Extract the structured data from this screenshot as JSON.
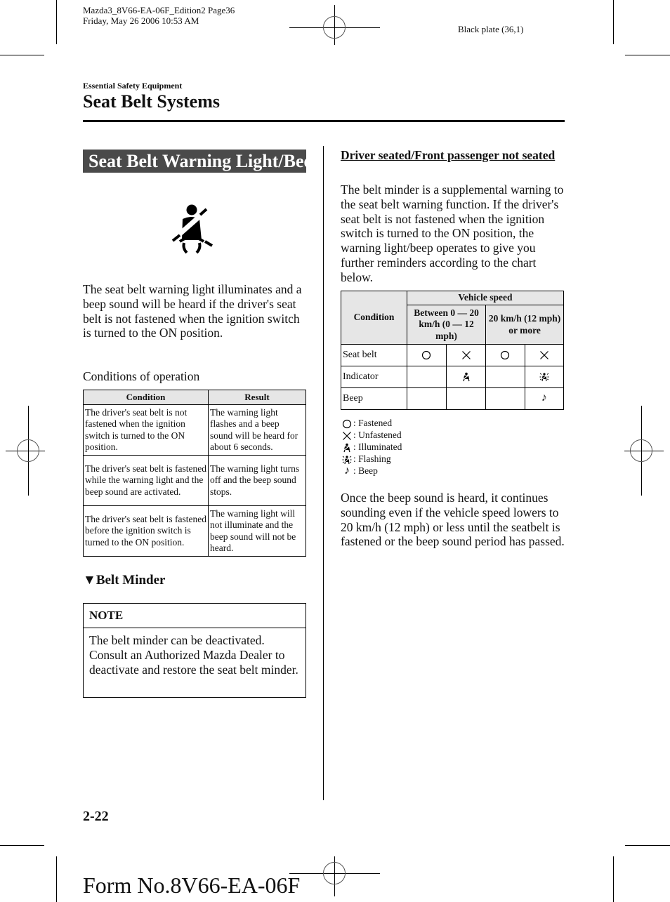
{
  "print_header": {
    "file_line": "Mazda3_8V66-EA-06F_Edition2 Page36",
    "date_line": "Friday, May 26 2006 10:53 AM",
    "plate": "Black plate (36,1)"
  },
  "section_label": "Essential Safety Equipment",
  "page_title": "Seat Belt Systems",
  "left_column": {
    "heading": "Seat Belt Warning Light/Beep",
    "warning_icon": "seat-belt-warning-icon",
    "intro": "The seat belt warning light illuminates and a beep sound will be heard if the driver's seat belt is not fastened when the ignition switch is turned to the ON position.",
    "conditions_label": "Conditions of operation",
    "conditions_table": {
      "headers": [
        "Condition",
        "Result"
      ],
      "rows": [
        [
          "The driver's seat belt is not fastened when the ignition switch is turned to the ON position.",
          "The warning light flashes and a beep sound will be heard for about 6 seconds."
        ],
        [
          "The driver's seat belt is fastened while the warning light and the beep sound are activated.",
          "The warning light turns off and the beep sound stops."
        ],
        [
          "The driver's seat belt is fastened before the ignition switch is turned to the ON position.",
          "The warning light will not illuminate and the beep sound will not be heard."
        ]
      ]
    },
    "belt_minder_heading": "Belt Minder",
    "note": {
      "title": "NOTE",
      "body": "The belt minder can be deactivated. Consult an Authorized Mazda Dealer to deactivate and restore the seat belt minder."
    }
  },
  "right_column": {
    "sub_heading": "Driver seated/Front passenger not seated",
    "intro": "The belt minder is a supplemental warning to the seat belt warning function. If the driver's seat belt is not fastened when the ignition switch is turned to the ON position, the warning light/beep operates to give you further reminders according to the chart below.",
    "speed_table": {
      "condition_header": "Condition",
      "group_header": "Vehicle speed",
      "speed_headers": [
        "Between 0 — 20 km/h (0 — 12 mph)",
        "20 km/h (12 mph) or more"
      ],
      "rows": [
        {
          "label": "Seat belt",
          "cells": [
            "fastened",
            "unfastened",
            "fastened",
            "unfastened"
          ]
        },
        {
          "label": "Indicator",
          "cells": [
            "",
            "illuminated",
            "",
            "flashing"
          ]
        },
        {
          "label": "Beep",
          "cells": [
            "",
            "",
            "",
            "beep"
          ]
        }
      ]
    },
    "legend": [
      {
        "symbol": "fastened",
        "label": ": Fastened"
      },
      {
        "symbol": "unfastened",
        "label": ": Unfastened"
      },
      {
        "symbol": "illuminated",
        "label": ": Illuminated"
      },
      {
        "symbol": "flashing",
        "label": ": Flashing"
      },
      {
        "symbol": "beep",
        "label": ": Beep"
      }
    ],
    "closing": "Once the beep sound is heard, it continues sounding even if the vehicle speed lowers to 20 km/h (12 mph) or less until the seatbelt is fastened or the beep sound period has passed."
  },
  "page_number": "2-22",
  "form_number": "Form No.8V66-EA-06F"
}
